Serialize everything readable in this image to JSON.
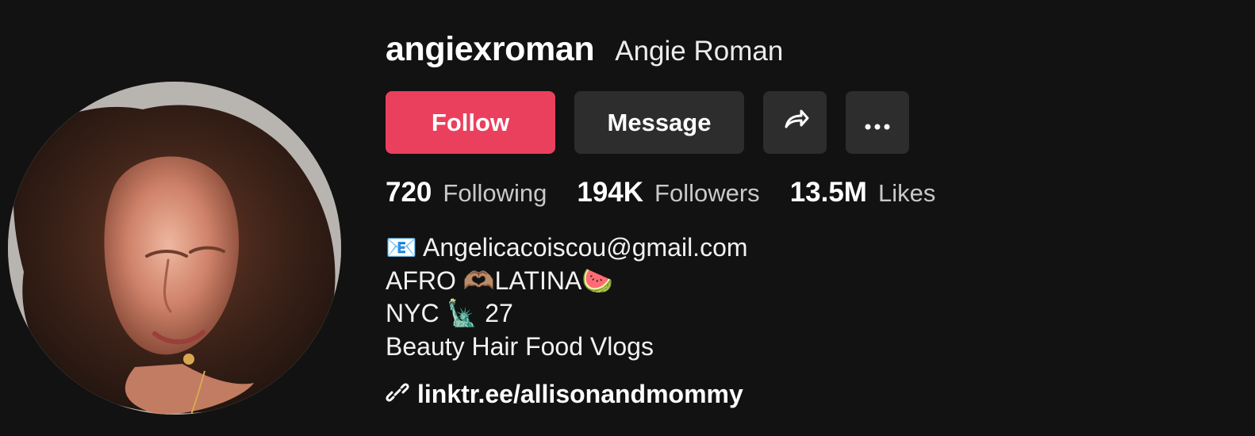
{
  "profile": {
    "username": "angiexroman",
    "display_name": "Angie Roman",
    "avatar_alt": "Profile avatar"
  },
  "actions": {
    "follow_label": "Follow",
    "message_label": "Message",
    "share_icon": "share-icon",
    "more_icon": "more-icon"
  },
  "stats": [
    {
      "value": "720",
      "label": "Following"
    },
    {
      "value": "194K",
      "label": "Followers"
    },
    {
      "value": "13.5M",
      "label": "Likes"
    }
  ],
  "bio": [
    "📧 Angelicacoiscou@gmail.com",
    "AFRO 🫶🏽LATINA🍉",
    "NYC 🗽 27",
    "Beauty Hair Food Vlogs"
  ],
  "link": {
    "text": "linktr.ee/allisonandmommy",
    "icon": "link-icon"
  },
  "colors": {
    "background": "#121212",
    "follow": "#ea405d",
    "secondary_button": "#2d2d2d",
    "muted_text": "#c9c9c9"
  }
}
